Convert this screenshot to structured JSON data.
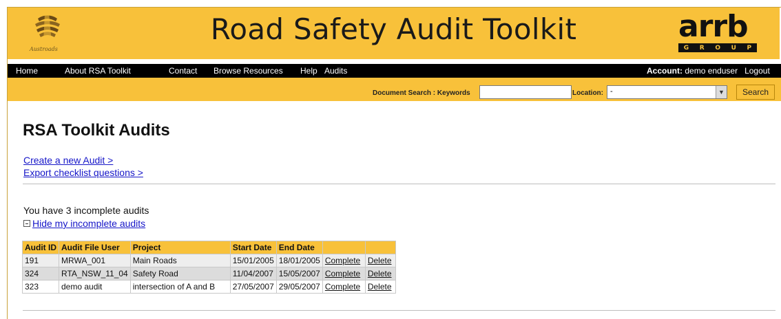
{
  "header": {
    "brand_left": "Austroads",
    "title": "Road Safety Audit Toolkit",
    "brand_right_main": "arrb",
    "brand_right_sub": [
      "G",
      "R",
      "O",
      "U",
      "P"
    ]
  },
  "nav": {
    "items": [
      "Home",
      "About RSA Toolkit",
      "Contact",
      "Browse Resources",
      "Help",
      "Audits"
    ],
    "account_label": "Account:",
    "account_user": "demo enduser",
    "logout": "Logout"
  },
  "search": {
    "keywords_label": "Document Search : Keywords",
    "keywords_value": "",
    "location_label": "Location:",
    "location_value": "-",
    "button": "Search"
  },
  "main": {
    "title": "RSA Toolkit Audits",
    "links": [
      "Create a new Audit >",
      "Export checklist questions >"
    ],
    "status": "You have 3 incomplete audits",
    "toggle": "Hide my incomplete audits"
  },
  "table": {
    "headers": [
      "Audit ID",
      "Audit File User",
      "Project",
      "Start Date",
      "End Date",
      "",
      ""
    ],
    "rows": [
      {
        "id": "191",
        "user": "MRWA_001",
        "project": "Main Roads",
        "start": "15/01/2005",
        "end": "18/01/2005",
        "complete": "Complete",
        "delete": "Delete"
      },
      {
        "id": "324",
        "user": "RTA_NSW_11_04",
        "project": "Safety Road",
        "start": "11/04/2007",
        "end": "15/05/2007",
        "complete": "Complete",
        "delete": "Delete"
      },
      {
        "id": "323",
        "user": "demo audit",
        "project": "intersection of A and B",
        "start": "27/05/2007",
        "end": "29/05/2007",
        "complete": "Complete",
        "delete": "Delete"
      }
    ]
  },
  "colors": {
    "accent": "#f8c13a",
    "nav_bg": "#000000",
    "link": "#1515c8"
  },
  "icons": {
    "austroads_logo": "austroads-logo-icon",
    "dropdown": "chevron-down-icon",
    "collapse": "minus-box-icon"
  }
}
